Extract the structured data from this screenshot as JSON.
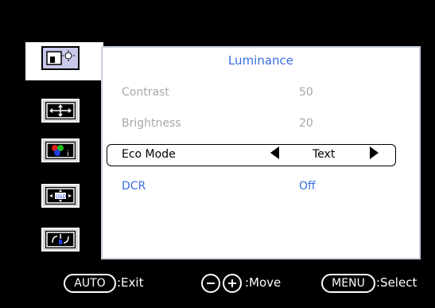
{
  "menu": {
    "title": "Luminance",
    "sidebar_icons": [
      "luminance-icon",
      "image-setup-icon",
      "color-setup-icon",
      "osd-setup-icon",
      "extra-icon"
    ],
    "rows": [
      {
        "label": "Contrast",
        "value": "50"
      },
      {
        "label": "Brightness",
        "value": "20"
      },
      {
        "label": "Eco Mode",
        "value": "Text"
      },
      {
        "label": "DCR",
        "value": "Off"
      }
    ]
  },
  "footer": {
    "auto_key": "AUTO",
    "auto_action": ":Exit",
    "move_action": ":Move",
    "menu_key": "MENU",
    "menu_action": ":Select"
  }
}
